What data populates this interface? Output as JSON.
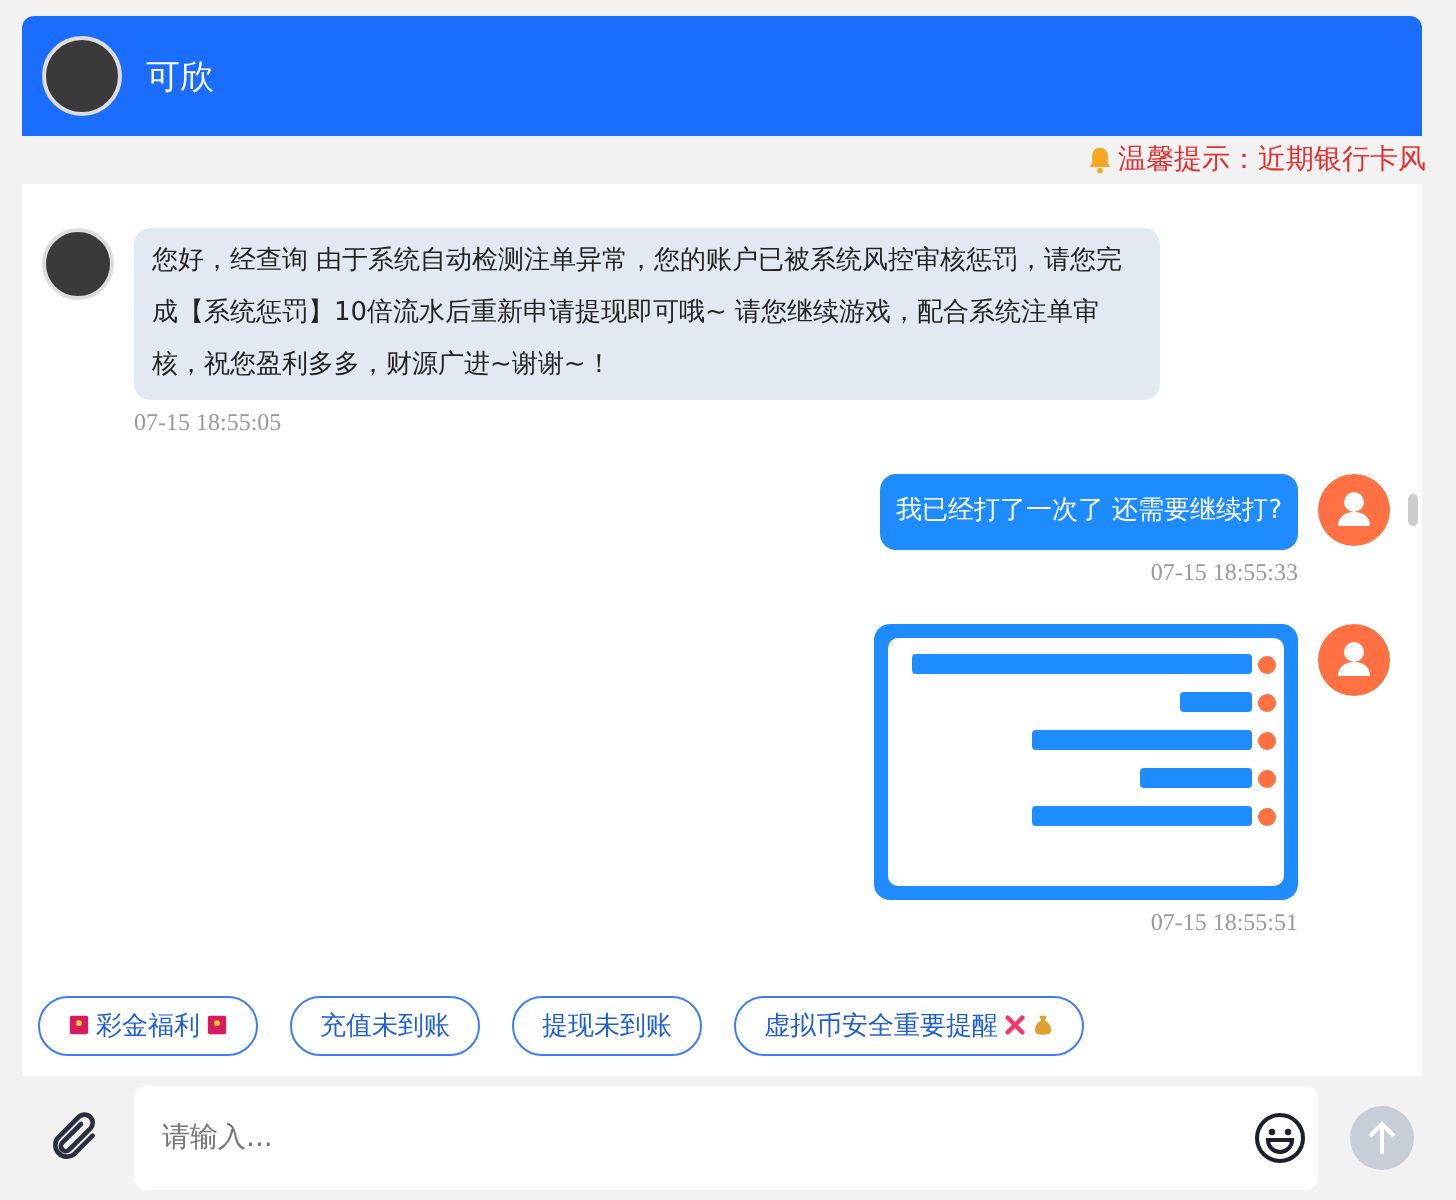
{
  "header": {
    "title": "可欣"
  },
  "notice": {
    "text": "温馨提示：近期银行卡风"
  },
  "messages": [
    {
      "outgoing": false,
      "kind": "text",
      "text": "您好，经查询 由于系统自动检测注单异常，您的账户已被系统风控审核惩罚，请您完成【系统惩罚】10倍流水后重新申请提现即可哦~ 请您继续游戏，配合系统注单审核，祝您盈利多多，财源广进~谢谢~！",
      "time": "07-15 18:55:05"
    },
    {
      "outgoing": true,
      "kind": "text",
      "text": "我已经打了一次了 还需要继续打?",
      "time": "07-15 18:55:33"
    },
    {
      "outgoing": true,
      "kind": "image",
      "time": "07-15 18:55:51"
    }
  ],
  "quick_replies": [
    {
      "label": "彩金福利",
      "kind": "envelope"
    },
    {
      "label": "充值未到账",
      "kind": "plain"
    },
    {
      "label": "提现未到账",
      "kind": "plain"
    },
    {
      "label": "虚拟币安全重要提醒",
      "kind": "warning"
    }
  ],
  "composer": {
    "placeholder": "请输入..."
  }
}
